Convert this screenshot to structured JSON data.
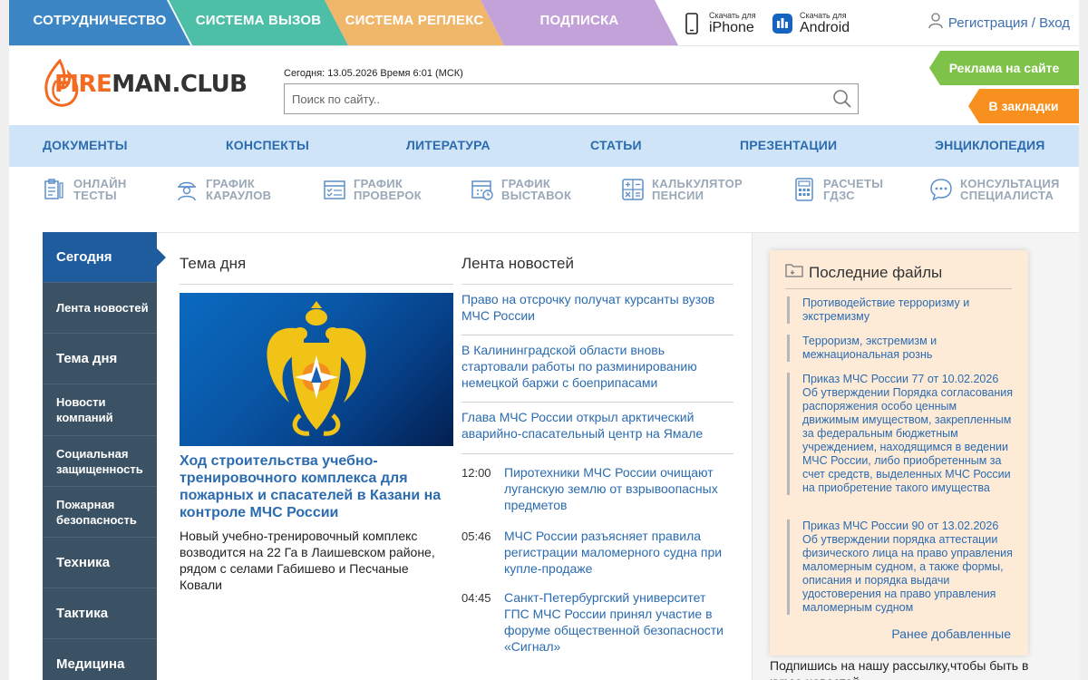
{
  "top_tabs": [
    "СОТРУДНИЧЕСТВО",
    "СИСТЕМА ВЫЗОВ",
    "СИСТЕМА РЕПЛЕКС",
    "ПОДПИСКА"
  ],
  "apps": {
    "ios": {
      "small": "Скачать для",
      "big": "iPhone"
    },
    "android": {
      "small": "Скачать для",
      "big": "Android"
    }
  },
  "auth": {
    "label": "Регистрация / Вход"
  },
  "logo": {
    "part1": "FI",
    "part2": "RE",
    "part3": "MAN.CLUB"
  },
  "date_line": "Сегодня: 13.05.2026 Время 6:01 (МСК)",
  "search": {
    "placeholder": "Поиск по сайту.."
  },
  "promo": {
    "ads": "Реклама на сайте",
    "bookmark": "В закладки"
  },
  "main_nav": [
    "ДОКУМЕНТЫ",
    "КОНСПЕКТЫ",
    "ЛИТЕРАТУРА",
    "СТАТЬИ",
    "ПРЕЗЕНТАЦИИ",
    "ЭНЦИКЛОПЕДИЯ"
  ],
  "tools": [
    {
      "line1": "ОНЛАЙН",
      "line2": "ТЕСТЫ",
      "icon": "test-clipboard-icon"
    },
    {
      "line1": "ГРАФИК",
      "line2": "КАРАУЛОВ",
      "icon": "firefighter-icon"
    },
    {
      "line1": "ГРАФИК",
      "line2": "ПРОВЕРОК",
      "icon": "checklist-calendar-icon"
    },
    {
      "line1": "ГРАФИК",
      "line2": "ВЫСТАВОК",
      "icon": "calendar-clock-icon"
    },
    {
      "line1": "КАЛЬКУЛЯТОР",
      "line2": "ПЕНСИИ",
      "icon": "calculator-icon"
    },
    {
      "line1": "РАСЧЕТЫ",
      "line2": "ГДЗС",
      "icon": "calculator-grid-icon"
    },
    {
      "line1": "КОНСУЛЬТАЦИЯ",
      "line2": "СПЕЦИАЛИСТА",
      "icon": "chat-bubble-icon"
    }
  ],
  "sidebar": [
    {
      "label": "Сегодня",
      "active": true
    },
    {
      "label": "Лента новостей"
    },
    {
      "label": "Тема дня"
    },
    {
      "label": "Новости компаний"
    },
    {
      "label": "Социальная защищенность"
    },
    {
      "label": "Пожарная безопасность"
    },
    {
      "label": "Техника"
    },
    {
      "label": "Тактика"
    },
    {
      "label": "Медицина"
    }
  ],
  "topic": {
    "heading": "Тема дня",
    "headline": "Ход строительства учебно-тренировочного комплекса для пожарных и спасателей в Казани на контроле МЧС России",
    "lead": "Новый учебно-тренировочный комплекс возводится на 22 Га в Лаишевском районе, рядом с селами Габишево и Песчаные Ковали"
  },
  "news": {
    "heading": "Лента новостей",
    "top_items": [
      "Право на отсрочку получат курсанты вузов МЧС России",
      "В Калининградской области вновь стартовали работы по разминированию немецкой баржи с боеприпасами",
      "Глава МЧС России открыл арктический аварийно-спасательный центр на Ямале"
    ],
    "timed_items": [
      {
        "time": "12:00",
        "text": "Пиротехники МЧС России очищают луганскую землю от взрывоопасных предметов"
      },
      {
        "time": "05:46",
        "text": "МЧС России разъясняет правила регистрации маломерного судна при купле-продаже"
      },
      {
        "time": "04:45",
        "text": "Санкт-Петербургский университет ГПС МЧС России принял участие в форуме общественной безопасности «Сигнал»"
      }
    ]
  },
  "files": {
    "heading": "Последние файлы",
    "items": [
      "Противодействие терроризму и экстремизму",
      "Терроризм, экстремизм и межнациональная рознь",
      "Приказ МЧС России 77 от 10.02.2026 Об утверждении Порядка согласования распоряжения особо ценным движимым имуществом, закрепленным за федеральным бюджетным учреждением, находящимся в ведении МЧС России, либо приобретенным за счет средств, выделенных МЧС России на приобретение такого имущества",
      "Приказ МЧС России 90 от 13.02.2026 Об утверждении порядка аттестации физического лица на право управления маломерным судном, а также формы, описания и порядка выдачи удостоверения на право управления маломерным судном"
    ],
    "more": "Ранее добавленные"
  },
  "subscribe": "Подпишись на нашу рассылку,чтобы быть в курсе новостей",
  "colors": {
    "tab1": "#3d86c6",
    "tab2": "#4cbfa6",
    "tab3": "#f0b66a",
    "tab4": "#c3a1d9",
    "link": "#2b6bb0",
    "sidebar": "#3b5265",
    "sidebar_active": "#1f5c9e",
    "nav_bg": "#cfe4f7",
    "promo_green": "#7fc24a",
    "promo_orange": "#f7901e"
  }
}
